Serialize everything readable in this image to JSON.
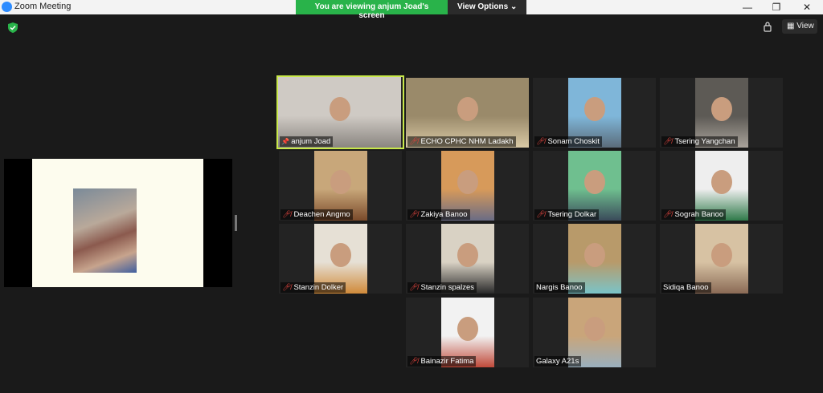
{
  "window": {
    "title": "Zoom Meeting"
  },
  "banner": {
    "message": "You are viewing anjum Joad's screen",
    "view_options": "View Options ⌄"
  },
  "controls": {
    "minimize": "—",
    "restore": "❐",
    "close": "✕"
  },
  "toolbar": {
    "view_label": "View"
  },
  "colors": {
    "banner_green": "#29b34a",
    "active_border": "#c8e84a",
    "mute_red": "#e0443e"
  },
  "participants": [
    {
      "name": "anjum Joad",
      "icon": "pin-icon",
      "muted": false
    },
    {
      "name": "ECHO CPHC NHM Ladakh",
      "muted": true
    },
    {
      "name": "Sonam Choskit",
      "muted": true
    },
    {
      "name": "Tsering Yangchan",
      "muted": true
    },
    {
      "name": "Deachen Angmo",
      "muted": true
    },
    {
      "name": "Zakiya Banoo",
      "muted": true
    },
    {
      "name": "Tsering Dolkar",
      "muted": true
    },
    {
      "name": "Sograh Banoo",
      "muted": true
    },
    {
      "name": "Stanzin Dolker",
      "muted": true
    },
    {
      "name": "Stanzin spalzes",
      "muted": true
    },
    {
      "name": "Nargis Banoo",
      "muted": false
    },
    {
      "name": "Sidiqa Banoo",
      "muted": false
    },
    {
      "name": "Bainazir Fatima",
      "muted": true
    },
    {
      "name": "Galaxy A21s",
      "muted": false
    }
  ]
}
